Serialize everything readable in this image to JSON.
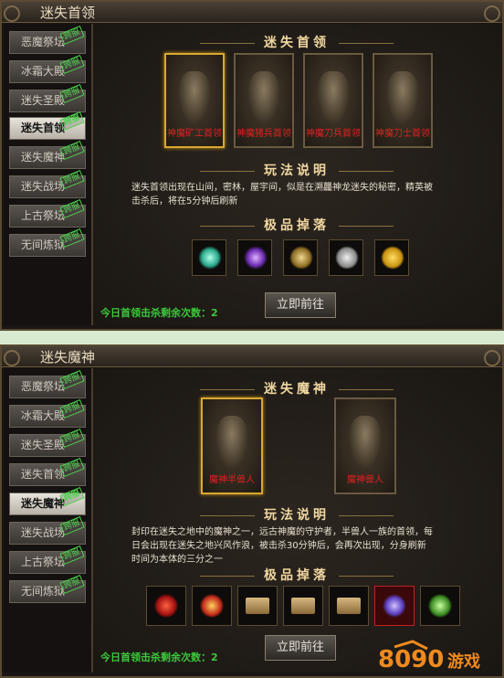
{
  "cross_server_label": "跨服",
  "panel1": {
    "title": "迷失首领",
    "sidebar": [
      "恶魔祭坛",
      "冰霜大殿",
      "迷失圣殿",
      "迷失首领",
      "迷失魔神",
      "迷失战场",
      "上古祭坛",
      "无间炼狱"
    ],
    "active_tab": 3,
    "section_title": "迷失首领",
    "bosses": [
      "神魔矿工首领",
      "神魔猪兵首领",
      "神魔刀兵首领",
      "神魔刀士首领"
    ],
    "rules_title": "玩法说明",
    "rules_text": [
      "迷失首领出现在山间，密林，屋宇间，似是在溯龘神龙迷失的秘密，精英被",
      "击杀后，将在5分钟后刷新"
    ],
    "drops_title": "极品掉落",
    "drops": [
      "spirit-wing-icon",
      "purple-sword-icon",
      "gold-ring-icon",
      "silver-ore-icon",
      "gold-ingot-icon"
    ],
    "go_button": "立即前往",
    "remaining_label": "今日首领击杀剩余次数：",
    "remaining_count": "2"
  },
  "panel2": {
    "title": "迷失魔神",
    "sidebar": [
      "恶魔祭坛",
      "冰霜大殿",
      "迷失圣殿",
      "迷失首领",
      "迷失魔神",
      "迷失战场",
      "上古祭坛",
      "无间炼狱"
    ],
    "active_tab": 4,
    "section_title": "迷失魔神",
    "bosses": [
      "魔神半兽人",
      "魔神兽人"
    ],
    "rules_title": "玩法说明",
    "rules_text": [
      "封印在迷失之地中的魔神之一，远古神魔的守护者，半兽人一族的首领，每",
      "日会出现在迷失之地兴风作浪，被击杀30分钟后，会再次出现，分身刷新",
      "时间为本体的三分之一"
    ],
    "drops_title": "极品掉落",
    "drops": [
      "red-dragon-icon",
      "fire-armor-icon",
      "scroll-icon",
      "scroll-icon",
      "scroll-icon",
      "purple-crystal-icon",
      "green-potion-icon"
    ],
    "go_button": "立即前往",
    "remaining_label": "今日首领击杀剩余次数：",
    "remaining_count": "2"
  },
  "brand": {
    "number": "8090",
    "text": "游戏"
  }
}
